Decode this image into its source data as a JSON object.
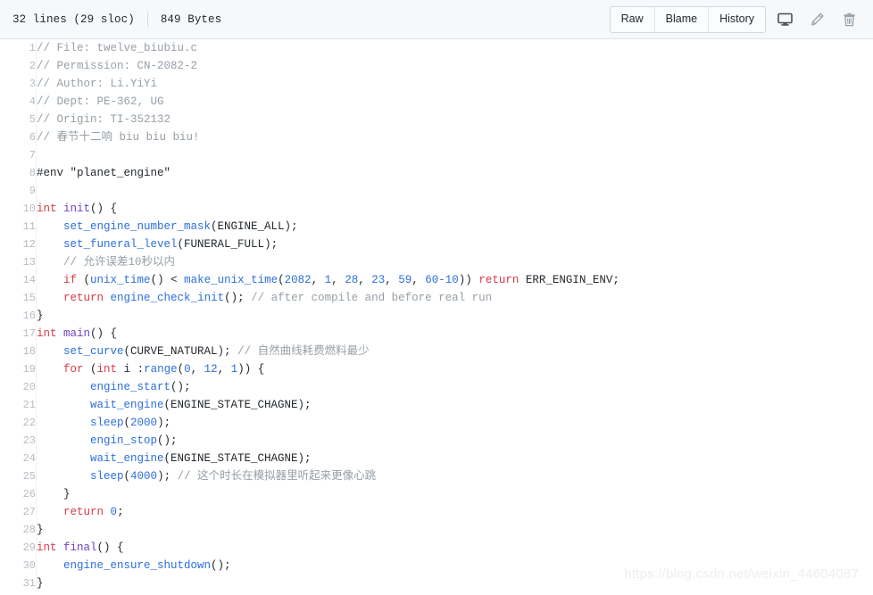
{
  "header": {
    "lines_label": "32 lines (29 sloc)",
    "size_label": "849 Bytes",
    "buttons": [
      {
        "label": "Raw",
        "name": "raw-button"
      },
      {
        "label": "Blame",
        "name": "blame-button"
      },
      {
        "label": "History",
        "name": "history-button"
      }
    ],
    "icons": [
      {
        "name": "desktop-icon",
        "title": "Open in desktop"
      },
      {
        "name": "pencil-icon",
        "title": "Edit this file"
      },
      {
        "name": "trash-icon",
        "title": "Delete this file"
      }
    ]
  },
  "code": {
    "language": "c",
    "line_count": 32,
    "visible_lines": 31,
    "lines": [
      {
        "n": "1",
        "tokens": [
          {
            "t": "// File: twelve_biubiu.c",
            "c": "c"
          }
        ]
      },
      {
        "n": "2",
        "tokens": [
          {
            "t": "// Permission: CN-2082-2",
            "c": "c"
          }
        ]
      },
      {
        "n": "3",
        "tokens": [
          {
            "t": "// Author: Li.YiYi",
            "c": "c"
          }
        ]
      },
      {
        "n": "4",
        "tokens": [
          {
            "t": "// Dept: PE-362, UG",
            "c": "c"
          }
        ]
      },
      {
        "n": "5",
        "tokens": [
          {
            "t": "// Origin: TI-352132",
            "c": "c"
          }
        ]
      },
      {
        "n": "6",
        "tokens": [
          {
            "t": "// 春节十二响 biu biu biu!",
            "c": "c"
          }
        ]
      },
      {
        "n": "7",
        "tokens": []
      },
      {
        "n": "8",
        "tokens": [
          {
            "t": "#env \"planet_engine\"",
            "c": "pp"
          }
        ]
      },
      {
        "n": "9",
        "tokens": []
      },
      {
        "n": "10",
        "tokens": [
          {
            "t": "int",
            "c": "k"
          },
          {
            "t": " ",
            "c": "id"
          },
          {
            "t": "init",
            "c": "fn"
          },
          {
            "t": "() {",
            "c": "id"
          }
        ]
      },
      {
        "n": "11",
        "tokens": [
          {
            "t": "    ",
            "c": "id"
          },
          {
            "t": "set_engine_number_mask",
            "c": "call"
          },
          {
            "t": "(ENGINE_ALL);",
            "c": "id"
          }
        ]
      },
      {
        "n": "12",
        "tokens": [
          {
            "t": "    ",
            "c": "id"
          },
          {
            "t": "set_funeral_level",
            "c": "call"
          },
          {
            "t": "(FUNERAL_FULL);",
            "c": "id"
          }
        ]
      },
      {
        "n": "13",
        "tokens": [
          {
            "t": "    ",
            "c": "id"
          },
          {
            "t": "// 允许误差10秒以内",
            "c": "c"
          }
        ]
      },
      {
        "n": "14",
        "tokens": [
          {
            "t": "    ",
            "c": "id"
          },
          {
            "t": "if",
            "c": "k"
          },
          {
            "t": " (",
            "c": "id"
          },
          {
            "t": "unix_time",
            "c": "call"
          },
          {
            "t": "() < ",
            "c": "id"
          },
          {
            "t": "make_unix_time",
            "c": "call"
          },
          {
            "t": "(",
            "c": "id"
          },
          {
            "t": "2082",
            "c": "n"
          },
          {
            "t": ", ",
            "c": "id"
          },
          {
            "t": "1",
            "c": "n"
          },
          {
            "t": ", ",
            "c": "id"
          },
          {
            "t": "28",
            "c": "n"
          },
          {
            "t": ", ",
            "c": "id"
          },
          {
            "t": "23",
            "c": "n"
          },
          {
            "t": ", ",
            "c": "id"
          },
          {
            "t": "59",
            "c": "n"
          },
          {
            "t": ", ",
            "c": "id"
          },
          {
            "t": "60-10",
            "c": "n"
          },
          {
            "t": ")) ",
            "c": "id"
          },
          {
            "t": "return",
            "c": "k"
          },
          {
            "t": " ERR_ENGIN_ENV;",
            "c": "id"
          }
        ]
      },
      {
        "n": "15",
        "tokens": [
          {
            "t": "    ",
            "c": "id"
          },
          {
            "t": "return",
            "c": "k"
          },
          {
            "t": " ",
            "c": "id"
          },
          {
            "t": "engine_check_init",
            "c": "call"
          },
          {
            "t": "(); ",
            "c": "id"
          },
          {
            "t": "// after compile and before real run",
            "c": "c"
          }
        ]
      },
      {
        "n": "16",
        "tokens": [
          {
            "t": "}",
            "c": "id"
          }
        ]
      },
      {
        "n": "17",
        "tokens": [
          {
            "t": "int",
            "c": "k"
          },
          {
            "t": " ",
            "c": "id"
          },
          {
            "t": "main",
            "c": "fn"
          },
          {
            "t": "() {",
            "c": "id"
          }
        ]
      },
      {
        "n": "18",
        "tokens": [
          {
            "t": "    ",
            "c": "id"
          },
          {
            "t": "set_curve",
            "c": "call"
          },
          {
            "t": "(CURVE_NATURAL); ",
            "c": "id"
          },
          {
            "t": "// 自然曲线耗费燃料最少",
            "c": "c"
          }
        ]
      },
      {
        "n": "19",
        "tokens": [
          {
            "t": "    ",
            "c": "id"
          },
          {
            "t": "for",
            "c": "k"
          },
          {
            "t": " (",
            "c": "id"
          },
          {
            "t": "int",
            "c": "k"
          },
          {
            "t": " i :",
            "c": "id"
          },
          {
            "t": "range",
            "c": "call"
          },
          {
            "t": "(",
            "c": "id"
          },
          {
            "t": "0",
            "c": "n"
          },
          {
            "t": ", ",
            "c": "id"
          },
          {
            "t": "12",
            "c": "n"
          },
          {
            "t": ", ",
            "c": "id"
          },
          {
            "t": "1",
            "c": "n"
          },
          {
            "t": ")) {",
            "c": "id"
          }
        ]
      },
      {
        "n": "20",
        "tokens": [
          {
            "t": "        ",
            "c": "id"
          },
          {
            "t": "engine_start",
            "c": "call"
          },
          {
            "t": "();",
            "c": "id"
          }
        ]
      },
      {
        "n": "21",
        "tokens": [
          {
            "t": "        ",
            "c": "id"
          },
          {
            "t": "wait_engine",
            "c": "call"
          },
          {
            "t": "(ENGINE_STATE_CHAGNE);",
            "c": "id"
          }
        ]
      },
      {
        "n": "22",
        "tokens": [
          {
            "t": "        ",
            "c": "id"
          },
          {
            "t": "sleep",
            "c": "call"
          },
          {
            "t": "(",
            "c": "id"
          },
          {
            "t": "2000",
            "c": "n"
          },
          {
            "t": ");",
            "c": "id"
          }
        ]
      },
      {
        "n": "23",
        "tokens": [
          {
            "t": "        ",
            "c": "id"
          },
          {
            "t": "engin_stop",
            "c": "call"
          },
          {
            "t": "();",
            "c": "id"
          }
        ]
      },
      {
        "n": "24",
        "tokens": [
          {
            "t": "        ",
            "c": "id"
          },
          {
            "t": "wait_engine",
            "c": "call"
          },
          {
            "t": "(ENGINE_STATE_CHAGNE);",
            "c": "id"
          }
        ]
      },
      {
        "n": "25",
        "tokens": [
          {
            "t": "        ",
            "c": "id"
          },
          {
            "t": "sleep",
            "c": "call"
          },
          {
            "t": "(",
            "c": "id"
          },
          {
            "t": "4000",
            "c": "n"
          },
          {
            "t": "); ",
            "c": "id"
          },
          {
            "t": "// 这个时长在模拟器里听起来更像心跳",
            "c": "c"
          }
        ]
      },
      {
        "n": "26",
        "tokens": [
          {
            "t": "    }",
            "c": "id"
          }
        ]
      },
      {
        "n": "27",
        "tokens": [
          {
            "t": "    ",
            "c": "id"
          },
          {
            "t": "return",
            "c": "k"
          },
          {
            "t": " ",
            "c": "id"
          },
          {
            "t": "0",
            "c": "n"
          },
          {
            "t": ";",
            "c": "id"
          }
        ]
      },
      {
        "n": "28",
        "tokens": [
          {
            "t": "}",
            "c": "id"
          }
        ]
      },
      {
        "n": "29",
        "tokens": [
          {
            "t": "int",
            "c": "k"
          },
          {
            "t": " ",
            "c": "id"
          },
          {
            "t": "final",
            "c": "fn"
          },
          {
            "t": "() {",
            "c": "id"
          }
        ]
      },
      {
        "n": "30",
        "tokens": [
          {
            "t": "    ",
            "c": "id"
          },
          {
            "t": "engine_ensure_shutdown",
            "c": "call"
          },
          {
            "t": "();",
            "c": "id"
          }
        ]
      },
      {
        "n": "31",
        "tokens": [
          {
            "t": "}",
            "c": "id"
          }
        ]
      }
    ]
  },
  "watermark": {
    "text": "https://blog.csdn.net/weixin_44604087"
  },
  "colors": {
    "header_bg": "#f6f8fa",
    "border": "#e1e4e8",
    "comment": "#969fa8",
    "keyword": "#d73a49",
    "definition": "#6f42c1",
    "call": "#2c6fdb",
    "number": "#2c6fdb",
    "text": "#24292e",
    "line_number": "#b6bcc4"
  }
}
